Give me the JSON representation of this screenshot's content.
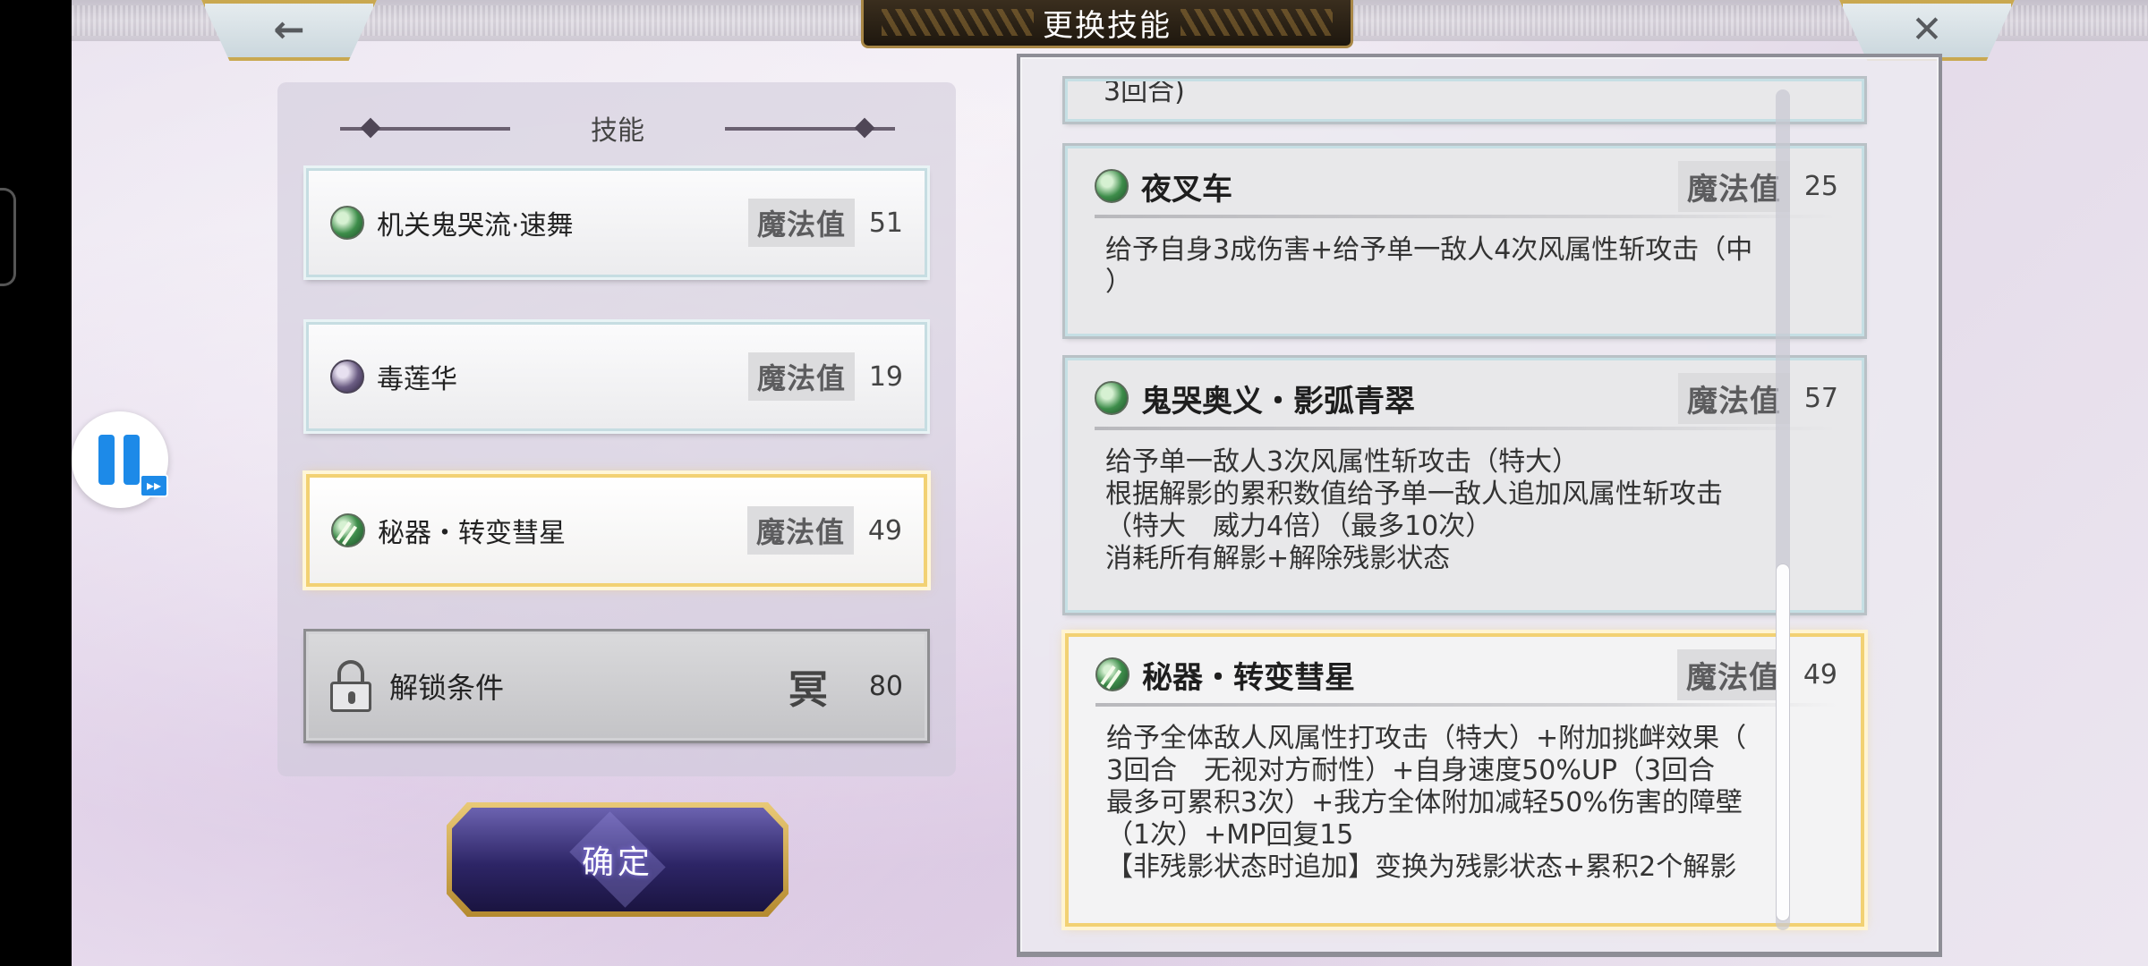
{
  "header": {
    "title": "更换技能",
    "back_icon": "←",
    "close_icon": "✕"
  },
  "skill_list": {
    "heading": "技能",
    "mp_label": "魔法值",
    "items": [
      {
        "name": "机关鬼哭流·速舞",
        "mp": "51",
        "icon": "wind-orb-icon",
        "state": "normal"
      },
      {
        "name": "毒莲华",
        "mp": "19",
        "icon": "poison-orb-icon",
        "state": "normal"
      },
      {
        "name": "秘器・转变彗星",
        "mp": "49",
        "icon": "comet-orb-icon",
        "state": "selected"
      }
    ],
    "locked": {
      "label": "解锁条件",
      "glyph": "冥",
      "value": "80"
    }
  },
  "confirm": {
    "label": "确定"
  },
  "details": {
    "partial_text": "3回合)",
    "mp_label": "魔法值",
    "cards": [
      {
        "name": "夜叉车",
        "mp": "25",
        "desc": "给予自身3成伤害+给予单一敌人4次风属性斩攻击（中\n）"
      },
      {
        "name": "鬼哭奥义・影弧青翠",
        "mp": "57",
        "desc": "给予单一敌人3次风属性斩攻击（特大）\n根据解影的累积数值给予单一敌人追加风属性斩攻击\n（特大　威力4倍）（最多10次）\n消耗所有解影+解除残影状态"
      },
      {
        "name": "秘器・转变彗星",
        "mp": "49",
        "desc": "给予全体敌人风属性打攻击（特大）+附加挑衅效果（\n3回合　无视对方耐性）+自身速度50%UP（3回合\n最多可累积3次）+我方全体附加减轻50%伤害的障壁\n（1次）+MP回复15\n【非残影状态时追加】变换为残影状态+累积2个解影"
      }
    ]
  },
  "overlay": {
    "pause_icon": "pause-icon",
    "ff_label": "▸▸"
  },
  "colors": {
    "accent_gold": "#f2d173",
    "confirm_purple": "#2d2566",
    "pause_blue": "#1d8ae8"
  }
}
